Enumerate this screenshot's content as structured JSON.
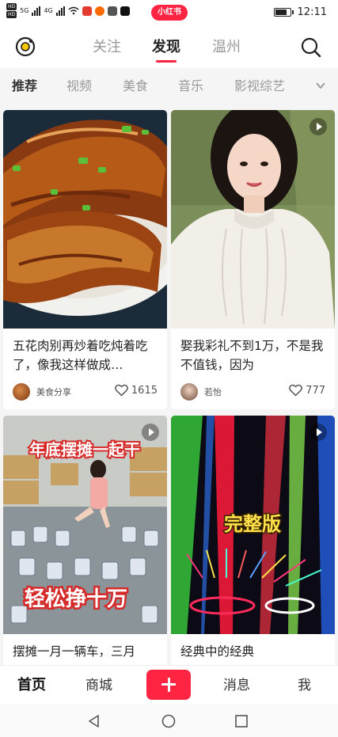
{
  "status_bar": {
    "network_left": [
      "HD",
      "HD"
    ],
    "network_5g": "5G",
    "network_4g": "4G",
    "center_app_label": "小红书",
    "time": "12:11",
    "battery_level": 0.8
  },
  "top_nav": {
    "tabs": [
      {
        "label": "关注",
        "active": false
      },
      {
        "label": "发现",
        "active": true
      },
      {
        "label": "温州",
        "active": false
      }
    ]
  },
  "categories": [
    {
      "label": "推荐",
      "active": true
    },
    {
      "label": "视频",
      "active": false
    },
    {
      "label": "美食",
      "active": false
    },
    {
      "label": "音乐",
      "active": false
    },
    {
      "label": "影视综艺",
      "active": false
    }
  ],
  "feed": {
    "cards": [
      {
        "title": "五花肉别再炒着吃炖着吃了，像我这样做成…",
        "author": "美食分享",
        "likes": "1615",
        "is_video": false,
        "thumb": "braised-pork-dish"
      },
      {
        "title": "娶我彩礼不到1万，不是我不值钱，因为",
        "author": "若怡",
        "likes": "777",
        "is_video": true,
        "thumb": "woman-white-sweater"
      },
      {
        "title": "摆摊一月一辆车，三月",
        "overlay_top": "年底摆摊一起干",
        "overlay_bottom": "轻松挣十万",
        "is_video": true,
        "thumb": "robot-toys-warehouse"
      },
      {
        "title": "经典中的经典",
        "overlay_text": "完整版",
        "is_video": true,
        "thumb": "stage-laser-lights"
      }
    ]
  },
  "tab_bar": {
    "tabs": [
      {
        "label": "首页",
        "active": true
      },
      {
        "label": "商城",
        "active": false
      },
      {
        "label": "消息",
        "active": false
      },
      {
        "label": "我",
        "active": false
      }
    ]
  },
  "colors": {
    "brand_red": "#ff2442",
    "text_dark": "#222222",
    "text_muted": "#999999",
    "feed_bg": "#f5f5f5"
  }
}
